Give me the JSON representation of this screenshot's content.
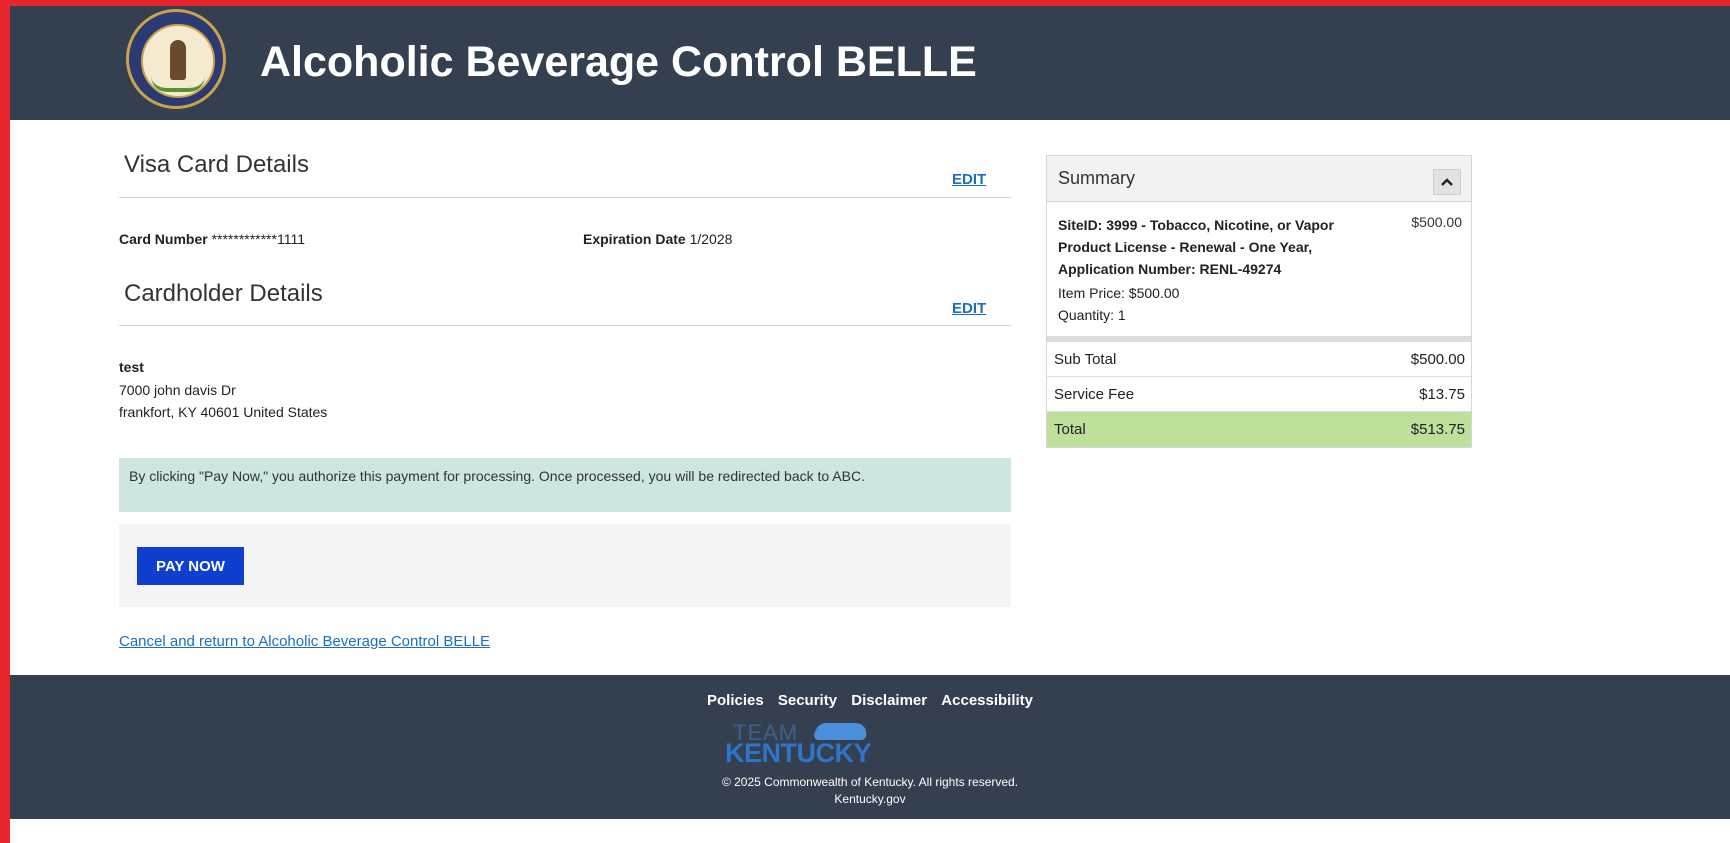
{
  "header": {
    "title": "Alcoholic Beverage Control BELLE",
    "seal_icon": "kentucky-seal"
  },
  "card_details": {
    "title": "Visa Card Details",
    "edit_label": "EDIT",
    "card_number_label": "Card Number",
    "card_number_value": "************1111",
    "expiration_label": "Expiration Date",
    "expiration_value": "1/2028"
  },
  "cardholder_details": {
    "title": "Cardholder Details",
    "edit_label": "EDIT",
    "name": "test",
    "address_line1": "7000 john davis Dr",
    "address_line2": "frankfort, KY 40601 United States"
  },
  "notice": {
    "text": "By clicking \"Pay Now,\" you authorize this payment for processing. Once processed, you will be redirected back to ABC."
  },
  "actions": {
    "pay_now_label": "PAY NOW",
    "cancel_label": "Cancel and return to Alcoholic Beverage Control BELLE"
  },
  "summary": {
    "title": "Summary",
    "collapse_icon": "chevron-up-icon",
    "item": {
      "description": "SiteID: 3999 - Tobacco, Nicotine, or Vapor Product License - Renewal - One Year, Application Number: RENL-49274",
      "price": "$500.00",
      "item_price_text": "Item Price: $500.00",
      "quantity_text": "Quantity: 1"
    },
    "rows": [
      {
        "label": "Sub Total",
        "value": "$500.00"
      },
      {
        "label": "Service Fee",
        "value": "$13.75"
      },
      {
        "label": "Total",
        "value": "$513.75"
      }
    ]
  },
  "footer": {
    "links": [
      "Policies",
      "Security",
      "Disclaimer",
      "Accessibility"
    ],
    "logo_team": "TEAM",
    "logo_kentucky": "KENTUCKY",
    "copyright": "© 2025 Commonwealth of Kentucky. All rights reserved.",
    "site": "Kentucky.gov"
  },
  "colors": {
    "header_bg": "#343f50",
    "accent_border": "#e8242c",
    "button_bg": "#0f3fce",
    "link": "#1d6ec2",
    "notice_bg": "#cde6e1",
    "total_bg": "#bfe09a"
  }
}
